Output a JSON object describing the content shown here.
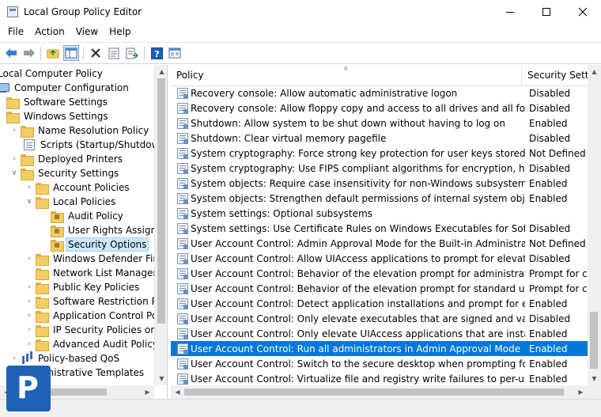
{
  "window": {
    "title": "Local Group Policy Editor",
    "icon": "gpedit-icon"
  },
  "menu": [
    "File",
    "Action",
    "View",
    "Help"
  ],
  "toolbar": {
    "buttons": [
      "back-icon",
      "forward-icon",
      "up-folder-icon",
      "show-hide-tree-icon",
      "delete-icon",
      "properties-icon",
      "export-list-icon",
      "help-icon",
      "extended-view-icon"
    ]
  },
  "tree": {
    "items": [
      {
        "label": "Local Computer Policy",
        "level": 0
      },
      {
        "label": "Computer Configuration",
        "level": 0
      },
      {
        "label": "Software Settings",
        "level": 1
      },
      {
        "label": "Windows Settings",
        "level": 1
      },
      {
        "label": "Name Resolution Policy",
        "level": 2
      },
      {
        "label": "Scripts (Startup/Shutdown)",
        "level": 2
      },
      {
        "label": "Deployed Printers",
        "level": 2
      },
      {
        "label": "Security Settings",
        "level": 2
      },
      {
        "label": "Account Policies",
        "level": 3
      },
      {
        "label": "Local Policies",
        "level": 3
      },
      {
        "label": "Audit Policy",
        "level": 4
      },
      {
        "label": "User Rights Assignment",
        "level": 4
      },
      {
        "label": "Security Options",
        "level": 4,
        "selected": true
      },
      {
        "label": "Windows Defender Firewall",
        "level": 3
      },
      {
        "label": "Network List Manager Policies",
        "level": 3
      },
      {
        "label": "Public Key Policies",
        "level": 3
      },
      {
        "label": "Software Restriction Policies",
        "level": 3
      },
      {
        "label": "Application Control Policies",
        "level": 3
      },
      {
        "label": "IP Security Policies on Local Computer",
        "level": 3
      },
      {
        "label": "Advanced Audit Policy",
        "level": 3
      },
      {
        "label": "Policy-based QoS",
        "level": 2
      },
      {
        "label": "Administrative Templates",
        "level": 1
      }
    ]
  },
  "list": {
    "headers": {
      "policy": "Policy",
      "setting": "Security Setting"
    },
    "rows": [
      {
        "policy": "Recovery console: Allow automatic administrative logon",
        "setting": "Disabled"
      },
      {
        "policy": "Recovery console: Allow floppy copy and access to all drives and all folders",
        "setting": "Disabled"
      },
      {
        "policy": "Shutdown: Allow system to be shut down without having to log on",
        "setting": "Enabled"
      },
      {
        "policy": "Shutdown: Clear virtual memory pagefile",
        "setting": "Disabled"
      },
      {
        "policy": "System cryptography: Force strong key protection for user keys stored on the ...",
        "setting": "Not Defined"
      },
      {
        "policy": "System cryptography: Use FIPS compliant algorithms for encryption, hashing, ...",
        "setting": "Disabled"
      },
      {
        "policy": "System objects: Require case insensitivity for non-Windows subsystems",
        "setting": "Enabled"
      },
      {
        "policy": "System objects: Strengthen default permissions of internal system objects (e.g....",
        "setting": "Enabled"
      },
      {
        "policy": "System settings: Optional subsystems",
        "setting": ""
      },
      {
        "policy": "System settings: Use Certificate Rules on Windows Executables for Software R...",
        "setting": "Disabled"
      },
      {
        "policy": "User Account Control: Admin Approval Mode for the Built-in Administrator a...",
        "setting": "Not Defined"
      },
      {
        "policy": "User Account Control: Allow UIAccess applications to prompt for elevation wi...",
        "setting": "Disabled"
      },
      {
        "policy": "User Account Control: Behavior of the elevation prompt for administrators in ...",
        "setting": "Prompt for consent"
      },
      {
        "policy": "User Account Control: Behavior of the elevation prompt for standard users",
        "setting": "Prompt for credentials"
      },
      {
        "policy": "User Account Control: Detect application installations and prompt for elevation",
        "setting": "Enabled"
      },
      {
        "policy": "User Account Control: Only elevate executables that are signed and validated",
        "setting": "Disabled"
      },
      {
        "policy": "User Account Control: Only elevate UIAccess applications that are installed in ...",
        "setting": "Enabled"
      },
      {
        "policy": "User Account Control: Run all administrators in Admin Approval Mode",
        "setting": "Enabled",
        "selected": true
      },
      {
        "policy": "User Account Control: Switch to the secure desktop when prompting for eleva...",
        "setting": "Enabled"
      },
      {
        "policy": "User Account Control: Virtualize file and registry write failures to per-user loca...",
        "setting": "Enabled"
      }
    ]
  },
  "watermark": {
    "letter": "P"
  },
  "colors": {
    "selection": "#0078d7",
    "tree_selection": "#cce8ff"
  }
}
